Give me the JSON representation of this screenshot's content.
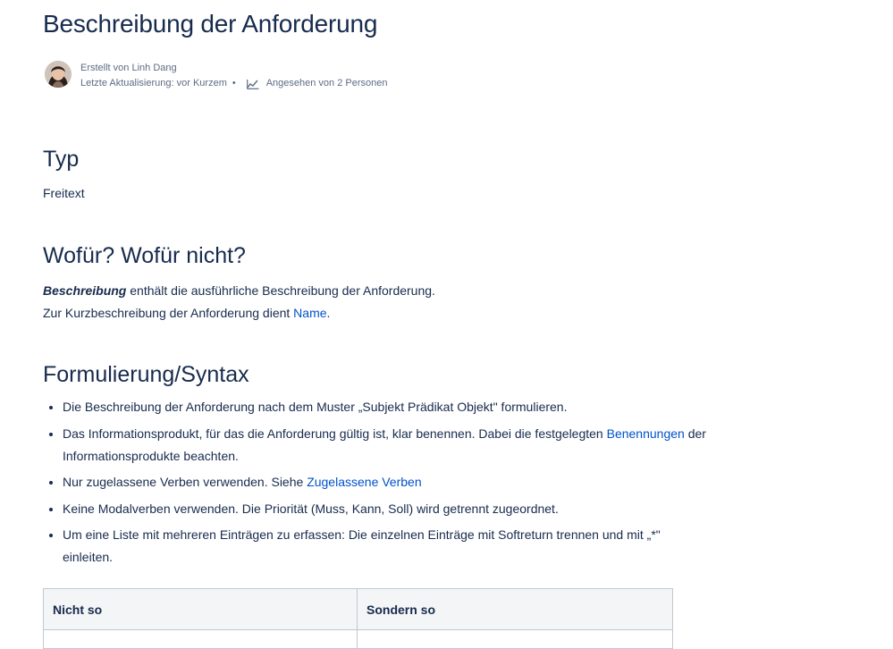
{
  "page": {
    "title": "Beschreibung der Anforderung",
    "byline": {
      "created_by": "Erstellt von Linh Dang",
      "last_updated": "Letzte Aktualisierung: vor Kurzem",
      "separator": "•",
      "views": "Angesehen von 2 Personen"
    }
  },
  "sections": {
    "typ": {
      "heading": "Typ",
      "text": "Freitext"
    },
    "wofuer": {
      "heading": "Wofür? Wofür nicht?",
      "line1_bold": "Beschreibung",
      "line1_rest": " enthält die ausführliche Beschreibung der Anforderung.",
      "line2_pre": "Zur Kurzbeschreibung der Anforderung dient ",
      "line2_link": "Name",
      "line2_post": "."
    },
    "syntax": {
      "heading": "Formulierung/Syntax",
      "b1": "Die Beschreibung der Anforderung nach dem Muster „Subjekt Prädikat Objekt\" formulieren.",
      "b2_pre": "Das Informationsprodukt, für das die Anforderung gültig ist, klar benennen. Dabei die festgelegten ",
      "b2_link": "Benennungen",
      "b2_post": " der Informationsprodukte beachten.",
      "b3_pre": "Nur zugelassene Verben verwenden. Siehe ",
      "b3_link": "Zugelassene Verben",
      "b4": "Keine Modalverben verwenden. Die Priorität (Muss, Kann, Soll) wird getrennt zugeordnet.",
      "b5": "Um eine Liste mit mehreren Einträgen zu erfassen: Die einzelnen Einträge mit Softreturn trennen und mit „*\" einleiten."
    }
  },
  "table": {
    "headers": [
      "Nicht so",
      "Sondern so"
    ]
  }
}
